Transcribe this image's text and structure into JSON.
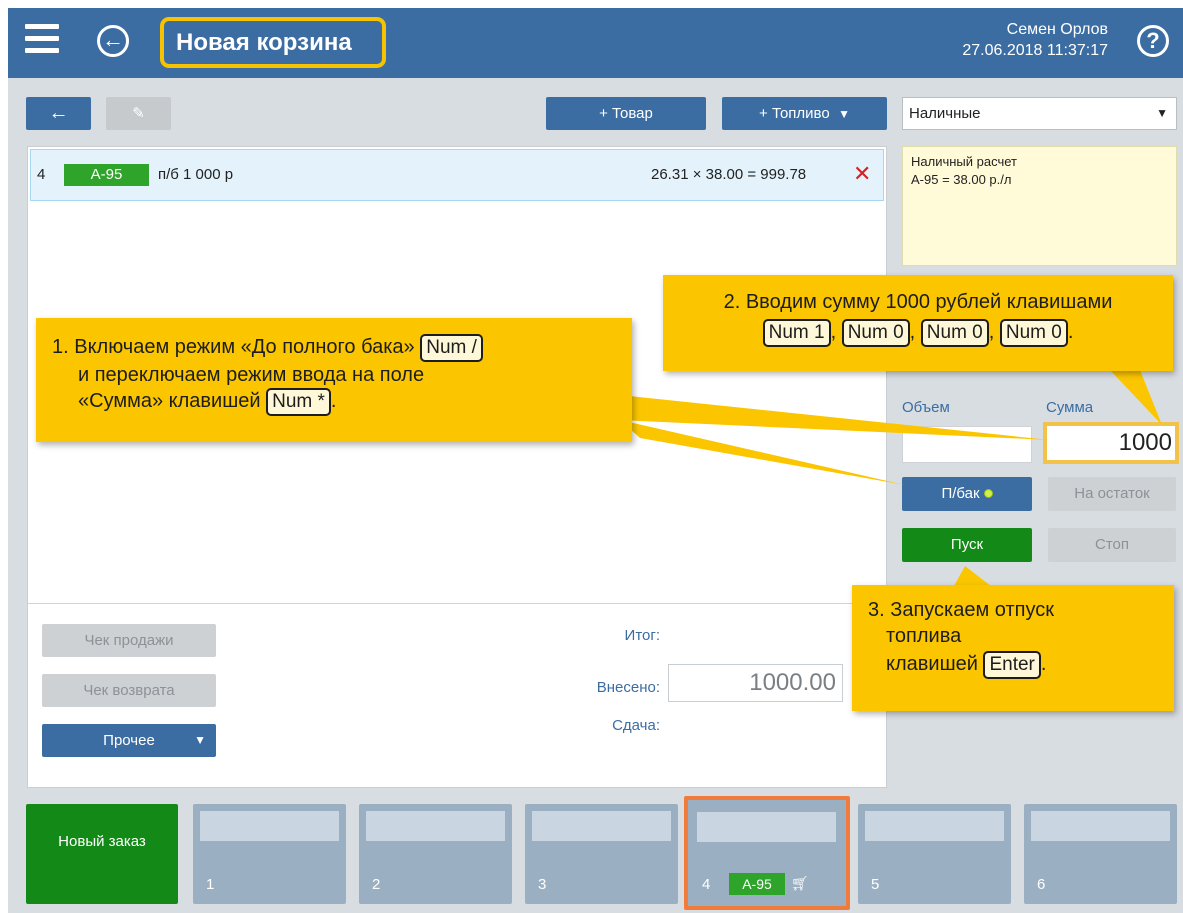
{
  "header": {
    "title": "Новая корзина",
    "user_name": "Семен Орлов",
    "datetime": "27.06.2018 11:37:17",
    "help_symbol": "?",
    "back_symbol": "←"
  },
  "toolbar": {
    "back_arrow": "←",
    "pencil": "✎",
    "add_goods": "+ Товар",
    "add_fuel": "+ Топливо",
    "add_fuel_caret": "▼",
    "payment_method": "Наличные",
    "payment_caret": "▼"
  },
  "basket": {
    "items": [
      {
        "num": "4",
        "fuel": "А-95",
        "description": "п/б 1 000 р",
        "calc": "26.31 × 38.00 = 999.78",
        "delete_symbol": "✕"
      }
    ],
    "receipt_sale": "Чек продажи",
    "receipt_return": "Чек возврата",
    "other": "Прочее",
    "other_caret": "▼",
    "total_label": "Итог:",
    "paid_label": "Внесено:",
    "paid_value": "1000.00",
    "change_label": "Сдача:"
  },
  "info": {
    "line1": "Наличный расчет",
    "line2": "А-95 = 38.00 р./л"
  },
  "dispense": {
    "volume_label": "Объем",
    "sum_label": "Сумма",
    "volume_value": "",
    "sum_value": "1000",
    "full_tank": "П/бак",
    "remainder": "На остаток",
    "start": "Пуск",
    "stop": "Стоп"
  },
  "orders": {
    "new_order": "Новый заказ",
    "slots": [
      {
        "num": "1",
        "fuel": "",
        "active": false
      },
      {
        "num": "2",
        "fuel": "",
        "active": false
      },
      {
        "num": "3",
        "fuel": "",
        "active": false
      },
      {
        "num": "4",
        "fuel": "А-95",
        "active": true
      },
      {
        "num": "5",
        "fuel": "",
        "active": false
      },
      {
        "num": "6",
        "fuel": "",
        "active": false
      }
    ]
  },
  "callouts": {
    "c1_part1": "1. Включаем режим «До полного бака»",
    "c1_key1": "Num /",
    "c1_part2": "и переключаем режим ввода на поле",
    "c1_part3": "«Сумма» клавишей",
    "c1_key2": "Num *",
    "c1_end": ".",
    "c2_line1": "2. Вводим сумму 1000 рублей клавишами",
    "c2_key1": "Num 1",
    "c2_key2": "Num 0",
    "c2_key3": "Num 0",
    "c2_key4": "Num 0",
    "c2_sep": ",",
    "c2_end": ".",
    "c3_line1": "3. Запускаем отпуск",
    "c3_line2": "топлива",
    "c3_line3": "клавишей",
    "c3_key": "Enter",
    "c3_end": "."
  },
  "colors": {
    "header_bg": "#3b6da2",
    "highlight": "#f7c200",
    "fuel_green": "#2fa42a",
    "start_green": "#138a17",
    "active_slot": "#f07b3a",
    "callout_bg": "#fbc600"
  }
}
